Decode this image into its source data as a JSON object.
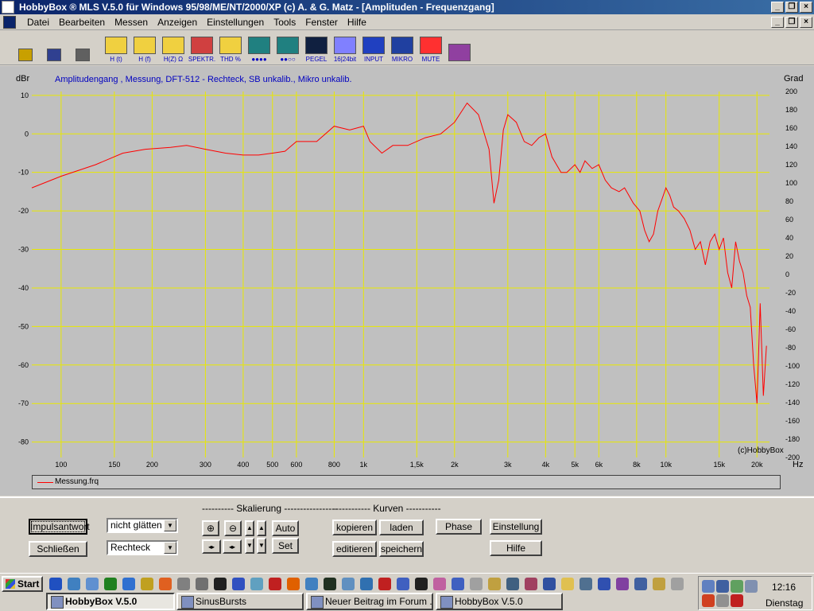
{
  "window": {
    "title": "HobbyBox ® MLS  V.5.0  für Windows 95/98/ME/NT/2000/XP    (c)  A. & G. Matz - [Amplituden - Frequenzgang]"
  },
  "menu": [
    "Datei",
    "Bearbeiten",
    "Messen",
    "Anzeigen",
    "Einstellungen",
    "Tools",
    "Fenster",
    "Hilfe"
  ],
  "toolbar": [
    {
      "label": "",
      "icon": "open-folder-icon"
    },
    {
      "label": "",
      "icon": "save-disk-icon"
    },
    {
      "label": "",
      "icon": "print-icon"
    },
    {
      "label": "H (t)",
      "icon": "impulse-response-icon"
    },
    {
      "label": "H (f)",
      "icon": "frequency-response-icon"
    },
    {
      "label": "H(Z) Ω",
      "icon": "impedance-icon"
    },
    {
      "label": "SPEKTR.",
      "icon": "spectrum-icon"
    },
    {
      "label": "THD %",
      "icon": "thd-icon"
    },
    {
      "label": "●●●●",
      "icon": "signal-icon"
    },
    {
      "label": "●●○○",
      "icon": "bars-icon"
    },
    {
      "label": "PEGEL",
      "icon": "level-icon"
    },
    {
      "label": "16|24bit",
      "icon": "bitdepth-icon"
    },
    {
      "label": "INPUT",
      "icon": "input-icon"
    },
    {
      "label": "MIKRO",
      "icon": "microphone-icon"
    },
    {
      "label": "MUTE",
      "icon": "mute-icon"
    },
    {
      "label": "",
      "icon": "probe-icon"
    }
  ],
  "plot": {
    "left_unit": "dBr",
    "right_unit": "Grad",
    "x_unit": "Hz",
    "subtitle": "Amplitudengang , Messung, DFT-512 - Rechteck, SB unkalib., Mikro unkalib.",
    "copyright": "(c)HobbyBox",
    "legend": "Messung.frq"
  },
  "chart_data": {
    "type": "line",
    "title": "Amplitudengang , Messung, DFT-512 - Rechteck, SB unkalib., Mikro unkalib.",
    "xlabel": "Hz",
    "ylabel": "dBr",
    "y2label": "Grad",
    "xscale": "log",
    "xlim": [
      80,
      22000
    ],
    "ylim": [
      -84,
      11
    ],
    "y2lim": [
      -200,
      200
    ],
    "x_ticks": [
      100,
      150,
      200,
      300,
      400,
      500,
      600,
      800,
      1000,
      1500,
      2000,
      3000,
      4000,
      5000,
      6000,
      8000,
      10000,
      15000,
      20000
    ],
    "x_tick_labels": [
      "100",
      "150",
      "200",
      "300",
      "400",
      "500",
      "600",
      "800",
      "1k",
      "1,5k",
      "2k",
      "3k",
      "4k",
      "5k",
      "6k",
      "8k",
      "10k",
      "15k",
      "20k"
    ],
    "y_ticks": [
      10,
      0,
      -10,
      -20,
      -30,
      -40,
      -50,
      -60,
      -70,
      -80
    ],
    "y2_ticks": [
      200,
      180,
      160,
      140,
      120,
      100,
      80,
      60,
      40,
      20,
      0,
      -20,
      -40,
      -60,
      -80,
      -100,
      -120,
      -140,
      -160,
      -180,
      -200
    ],
    "grid": true,
    "legend_position": "bottom",
    "series": [
      {
        "name": "Messung.frq",
        "color": "#ff0000",
        "x": [
          80,
          100,
          130,
          160,
          190,
          230,
          260,
          300,
          350,
          400,
          450,
          500,
          550,
          600,
          700,
          800,
          900,
          1000,
          1050,
          1150,
          1250,
          1400,
          1600,
          1800,
          2000,
          2200,
          2400,
          2600,
          2700,
          2800,
          2900,
          3000,
          3200,
          3400,
          3600,
          3800,
          4000,
          4200,
          4500,
          4700,
          5000,
          5200,
          5400,
          5700,
          6000,
          6300,
          6600,
          7000,
          7300,
          7800,
          8200,
          8500,
          8800,
          9100,
          9400,
          9700,
          10000,
          10300,
          10600,
          11000,
          11500,
          12000,
          12500,
          13000,
          13500,
          14000,
          14500,
          15000,
          15500,
          16000,
          16500,
          17000,
          17500,
          18000,
          18500,
          19000,
          19500,
          20000,
          20500,
          21000,
          21500
        ],
        "y": [
          -14,
          -11,
          -8,
          -5,
          -4,
          -3.5,
          -3,
          -4,
          -5,
          -5.5,
          -5.5,
          -5,
          -4.5,
          -2,
          -2,
          2,
          1,
          2,
          -2,
          -5,
          -3,
          -3,
          -1,
          0,
          3,
          8,
          5,
          -4,
          -18,
          -12,
          1,
          5,
          3,
          -2,
          -3,
          -1,
          0,
          -6,
          -10,
          -10,
          -8,
          -10,
          -7,
          -9,
          -8,
          -12,
          -14,
          -15,
          -14,
          -18,
          -20,
          -25,
          -28,
          -26,
          -20,
          -17,
          -14,
          -16,
          -19,
          -20,
          -22,
          -25,
          -30,
          -28,
          -34,
          -28,
          -26,
          -30,
          -27,
          -36,
          -40,
          -28,
          -33,
          -36,
          -42,
          -45,
          -60,
          -70,
          -44,
          -68,
          -55
        ]
      }
    ]
  },
  "controls": {
    "impulse_button": "Impulsantwort",
    "close_button": "Schließen",
    "smooth_select": "nicht glätten",
    "window_select": "Rechteck",
    "scaling_group": "---------- Skalierung -----------------",
    "auto_button": "Auto",
    "set_button": "Set",
    "curves_group": "------------ Kurven  -----------",
    "copy_button": "kopieren",
    "load_button": "laden",
    "edit_button": "editieren",
    "save_button": "speichern",
    "phase_button": "Phase",
    "settings_button": "Einstellung",
    "help_button": "Hilfe"
  },
  "taskbar": {
    "start": "Start",
    "tasks": [
      "HobbyBox V.5.0",
      "SinusBursts",
      "Neuer Beitrag im Forum ...",
      "HobbyBox V.5.0"
    ],
    "clock": "12:16",
    "day": "Dienstag"
  }
}
